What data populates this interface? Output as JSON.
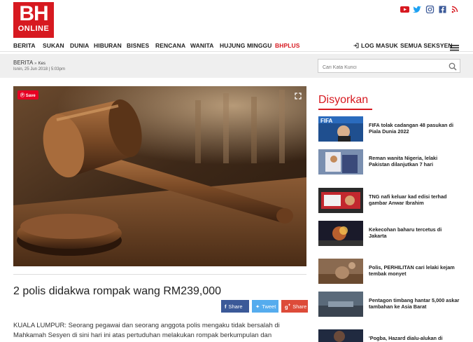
{
  "logo": {
    "top": "BH",
    "bottom": "ONLINE"
  },
  "social": [
    "youtube-icon",
    "twitter-icon",
    "instagram-icon",
    "facebook-icon",
    "rss-icon"
  ],
  "nav": {
    "items": [
      "BERITA",
      "SUKAN",
      "DUNIA",
      "HIBURAN",
      "BISNES",
      "RENCANA",
      "WANITA",
      "HUJUNG MINGGU",
      "BHPLUS"
    ],
    "login": "LOG MASUK",
    "sections": "SEMUA SEKSYEN"
  },
  "breadcrumb": {
    "section": "BERITA",
    "sep": "»",
    "sub": "Kes"
  },
  "date": "Isnin, 25 Jun 2018 | 5:03pm",
  "search": {
    "placeholder": "Cari Kata Kunci"
  },
  "hero": {
    "save_label": "Save"
  },
  "article": {
    "title": "2 polis didakwa rompak wang RM239,000",
    "body": "KUALA LUMPUR: Seorang pegawai dan seorang anggota polis mengaku tidak bersalah di Mahkamah Sesyen di sini hari ini atas pertuduhan melakukan rompak berkumpulan dan"
  },
  "share": {
    "facebook": "Share",
    "twitter": "Tweet",
    "googleplus": "Share"
  },
  "sidebar": {
    "title": "Disyorkan",
    "items": [
      {
        "text": "FIFA tolak cadangan 48 pasukan di Piala Dunia 2022"
      },
      {
        "text": "Reman wanita Nigeria, lelaki Pakistan dilanjutkan 7 hari"
      },
      {
        "text": "TNG nafi keluar kad edisi terhad gambar Anwar Ibrahim"
      },
      {
        "text": "Kekecohan baharu tercetus di Jakarta"
      },
      {
        "text": "Polis, PERHILITAN cari lelaki kejam tembak monyet"
      },
      {
        "text": "Pentagon timbang hantar 5,000 askar tambahan ke Asia Barat"
      },
      {
        "text": "'Pogba, Hazard dialu-alukan di"
      }
    ]
  },
  "colors": {
    "brand": "#d71920",
    "facebook": "#3b5998",
    "twitter": "#55acee",
    "googleplus": "#dd4b39"
  }
}
